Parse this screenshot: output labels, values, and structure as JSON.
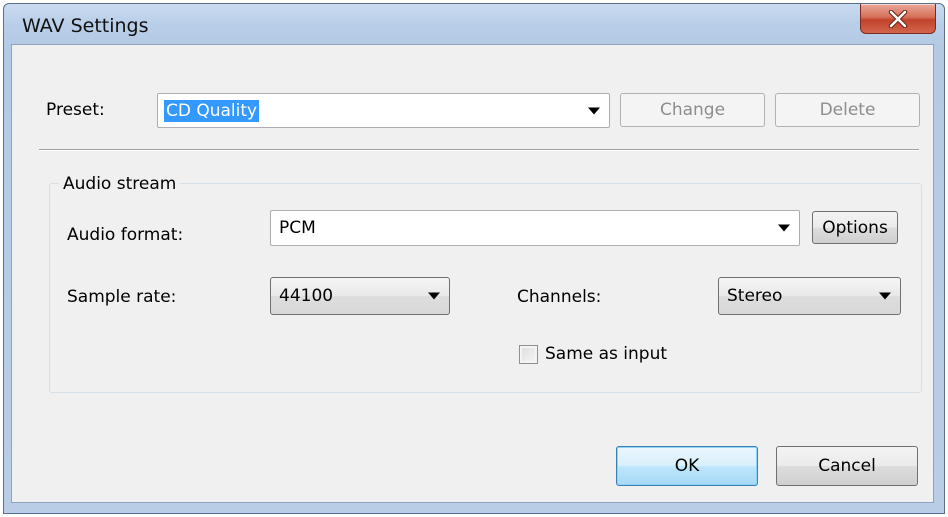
{
  "window": {
    "title": "WAV Settings"
  },
  "preset": {
    "label": "Preset:",
    "value": "CD Quality",
    "change_label": "Change",
    "delete_label": "Delete"
  },
  "audio_stream": {
    "group_title": "Audio stream",
    "format_label": "Audio format:",
    "format_value": "PCM",
    "options_label": "Options",
    "sample_rate_label": "Sample rate:",
    "sample_rate_value": "44100",
    "channels_label": "Channels:",
    "channels_value": "Stereo",
    "same_as_input_label": "Same as input",
    "same_as_input_checked": false
  },
  "footer": {
    "ok_label": "OK",
    "cancel_label": "Cancel"
  },
  "icons": {
    "close": "close-icon",
    "dropdown": "chevron-down-icon"
  },
  "colors": {
    "selection": "#3399ff",
    "close_button": "#c0432a",
    "default_button_border": "#3c7fb1"
  }
}
